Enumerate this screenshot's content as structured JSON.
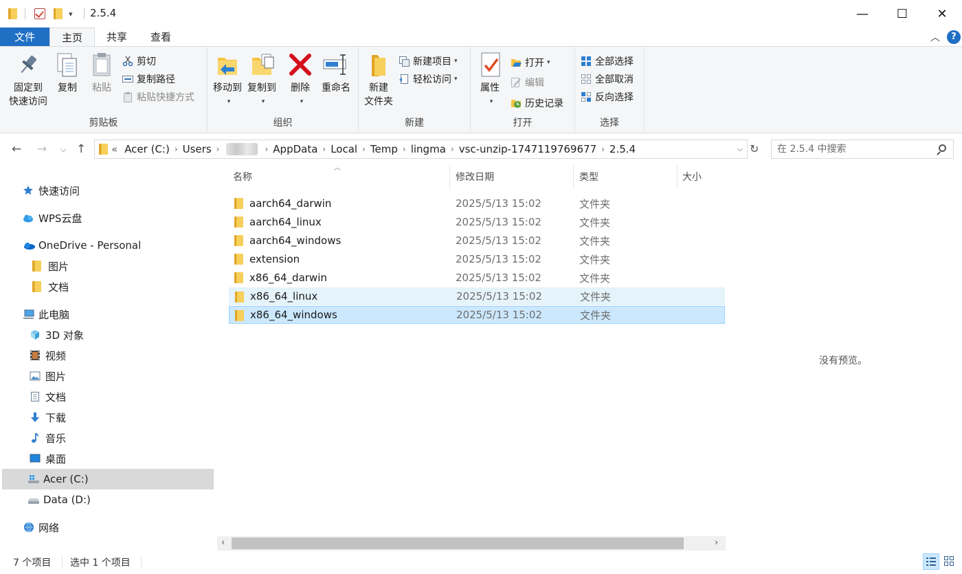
{
  "window": {
    "title": "2.5.4",
    "minimize_glyph": "—",
    "maximize_glyph": "☐",
    "close_glyph": "✕"
  },
  "ribbon_tabs": [
    {
      "label": "文件"
    },
    {
      "label": "主页"
    },
    {
      "label": "共享"
    },
    {
      "label": "查看"
    }
  ],
  "ribbon": {
    "clipboard": {
      "label": "剪贴板",
      "pin_line1": "固定到",
      "pin_line2": "快速访问",
      "copy": "复制",
      "paste": "粘贴",
      "cut": "剪切",
      "copy_path": "复制路径",
      "paste_shortcut": "粘贴快捷方式"
    },
    "organize": {
      "label": "组织",
      "move_to": "移动到",
      "copy_to": "复制到",
      "delete": "删除",
      "rename": "重命名"
    },
    "new": {
      "label": "新建",
      "new_folder_line1": "新建",
      "new_folder_line2": "文件夹",
      "new_item": "新建项目",
      "easy_access": "轻松访问"
    },
    "open": {
      "label": "打开",
      "properties": "属性",
      "open": "打开",
      "edit": "编辑",
      "history": "历史记录"
    },
    "select": {
      "label": "选择",
      "select_all": "全部选择",
      "select_none": "全部取消",
      "invert": "反向选择"
    }
  },
  "address": {
    "overflow": "«",
    "crumbs": [
      "Acer (C:)",
      "Users",
      "AppData",
      "Local",
      "Temp",
      "lingma",
      "vsc-unzip-1747119769677",
      "2.5.4"
    ],
    "search_placeholder": "在 2.5.4 中搜索"
  },
  "nav_pane": [
    {
      "label": "快速访问",
      "icon": "star-icon"
    },
    {
      "label": "WPS云盘",
      "icon": "cloud-icon"
    },
    {
      "label": "OneDrive - Personal",
      "icon": "onedrive-icon"
    },
    {
      "label": "图片",
      "icon": "folder-icon"
    },
    {
      "label": "文档",
      "icon": "folder-icon"
    },
    {
      "label": "此电脑",
      "icon": "computer-icon"
    },
    {
      "label": "3D 对象",
      "icon": "cube-icon"
    },
    {
      "label": "视频",
      "icon": "film-icon"
    },
    {
      "label": "图片",
      "icon": "pictures-icon"
    },
    {
      "label": "文档",
      "icon": "document-icon"
    },
    {
      "label": "下载",
      "icon": "download-icon"
    },
    {
      "label": "音乐",
      "icon": "music-icon"
    },
    {
      "label": "桌面",
      "icon": "desktop-icon"
    },
    {
      "label": "Acer (C:)",
      "icon": "drive-c-icon"
    },
    {
      "label": "Data (D:)",
      "icon": "drive-icon"
    },
    {
      "label": "网络",
      "icon": "network-icon"
    }
  ],
  "columns": [
    "名称",
    "修改日期",
    "类型",
    "大小"
  ],
  "files": [
    {
      "name": "aarch64_darwin",
      "date": "2025/5/13 15:02",
      "type": "文件夹"
    },
    {
      "name": "aarch64_linux",
      "date": "2025/5/13 15:02",
      "type": "文件夹"
    },
    {
      "name": "aarch64_windows",
      "date": "2025/5/13 15:02",
      "type": "文件夹"
    },
    {
      "name": "extension",
      "date": "2025/5/13 15:02",
      "type": "文件夹"
    },
    {
      "name": "x86_64_darwin",
      "date": "2025/5/13 15:02",
      "type": "文件夹"
    },
    {
      "name": "x86_64_linux",
      "date": "2025/5/13 15:02",
      "type": "文件夹"
    },
    {
      "name": "x86_64_windows",
      "date": "2025/5/13 15:02",
      "type": "文件夹"
    }
  ],
  "preview": {
    "text": "没有预览。"
  },
  "status": {
    "count": "7 个项目",
    "selected": "选中 1 个项目"
  },
  "colors": {
    "accent": "#1f6fc5",
    "selection": "#cce8ff",
    "hover": "#e5f3fb"
  }
}
